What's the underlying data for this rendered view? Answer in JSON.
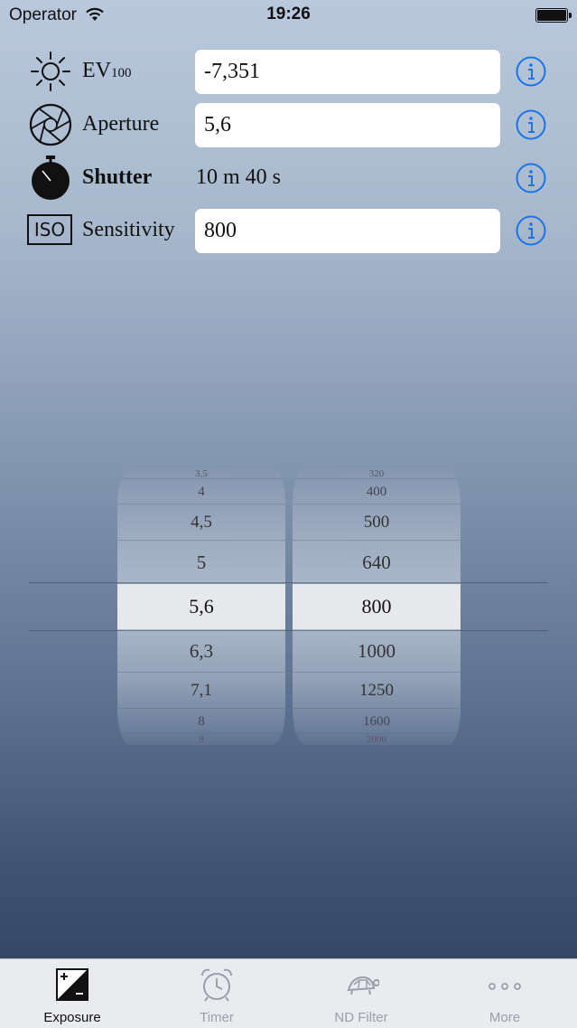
{
  "status_bar": {
    "carrier": "Operator",
    "time": "19:26"
  },
  "rows": {
    "ev": {
      "label": "EV",
      "label_sub": "100",
      "value": "-7,351"
    },
    "aperture": {
      "label": "Aperture",
      "value": "5,6"
    },
    "shutter": {
      "label": "Shutter",
      "value": "10 m 40 s"
    },
    "sensitivity": {
      "label": "Sensitivity",
      "value": "800",
      "icon_text": "ISO"
    }
  },
  "picker": {
    "aperture": {
      "above": [
        "3,5",
        "4",
        "4,5",
        "5"
      ],
      "selected": "5,6",
      "below": [
        "6,3",
        "7,1",
        "8",
        "9"
      ]
    },
    "iso": {
      "above": [
        "320",
        "400",
        "500",
        "640"
      ],
      "selected": "800",
      "below": [
        "1000",
        "1250",
        "1600",
        "2000"
      ]
    }
  },
  "tabbar": {
    "tabs": [
      {
        "label": "Exposure",
        "icon": "exposure-icon",
        "active": true
      },
      {
        "label": "Timer",
        "icon": "alarm-clock-icon",
        "active": false
      },
      {
        "label": "ND Filter",
        "icon": "turtle-icon",
        "active": false
      },
      {
        "label": "More",
        "icon": "more-dots-icon",
        "active": false
      }
    ]
  },
  "colors": {
    "accent": "#1a73e8",
    "tab_inactive": "#9aa0a8"
  }
}
